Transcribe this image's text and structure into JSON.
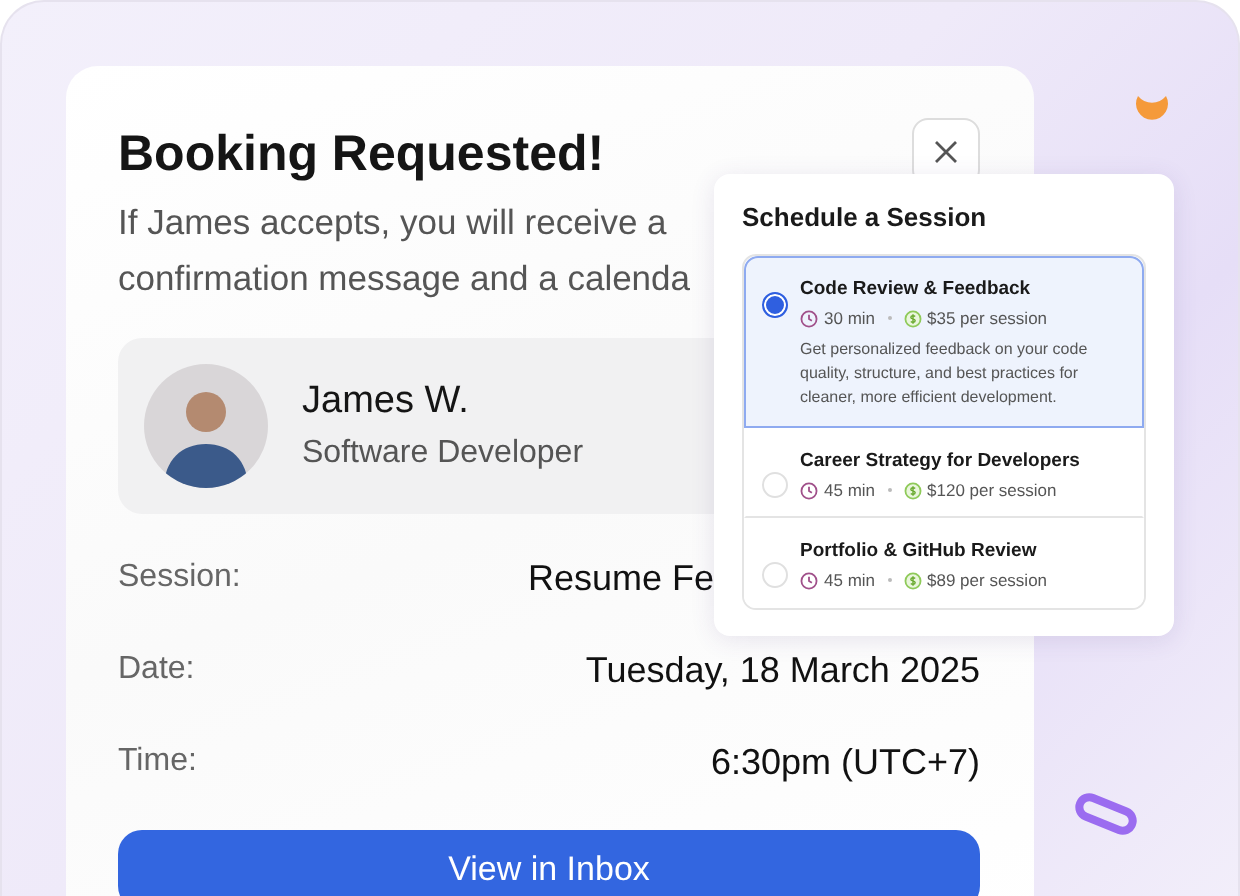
{
  "card": {
    "title": "Booking Requested!",
    "message_lines": [
      "If James accepts, you will receive a",
      "confirmation message and a calenda"
    ],
    "profile": {
      "name": "James W.",
      "role": "Software Developer"
    },
    "details": [
      {
        "label": "Session:",
        "value": "Resume Fe"
      },
      {
        "label": "Date:",
        "value": "Tuesday, 18 March 2025"
      },
      {
        "label": "Time:",
        "value": "6:30pm (UTC+7)"
      }
    ],
    "button": "View in Inbox"
  },
  "popup": {
    "title": "Schedule a Session",
    "sessions": [
      {
        "name": "Code Review & Feedback",
        "duration": "30 min",
        "price": "$35 per session",
        "description": "Get personalized feedback on your code quality, structure, and best practices for cleaner, more efficient development.",
        "selected": true
      },
      {
        "name": "Career Strategy for Developers",
        "duration": "45 min",
        "price": "$120 per session",
        "selected": false
      },
      {
        "name": "Portfolio & GitHub Review",
        "duration": "45 min",
        "price": "$89 per session",
        "selected": false
      }
    ]
  }
}
